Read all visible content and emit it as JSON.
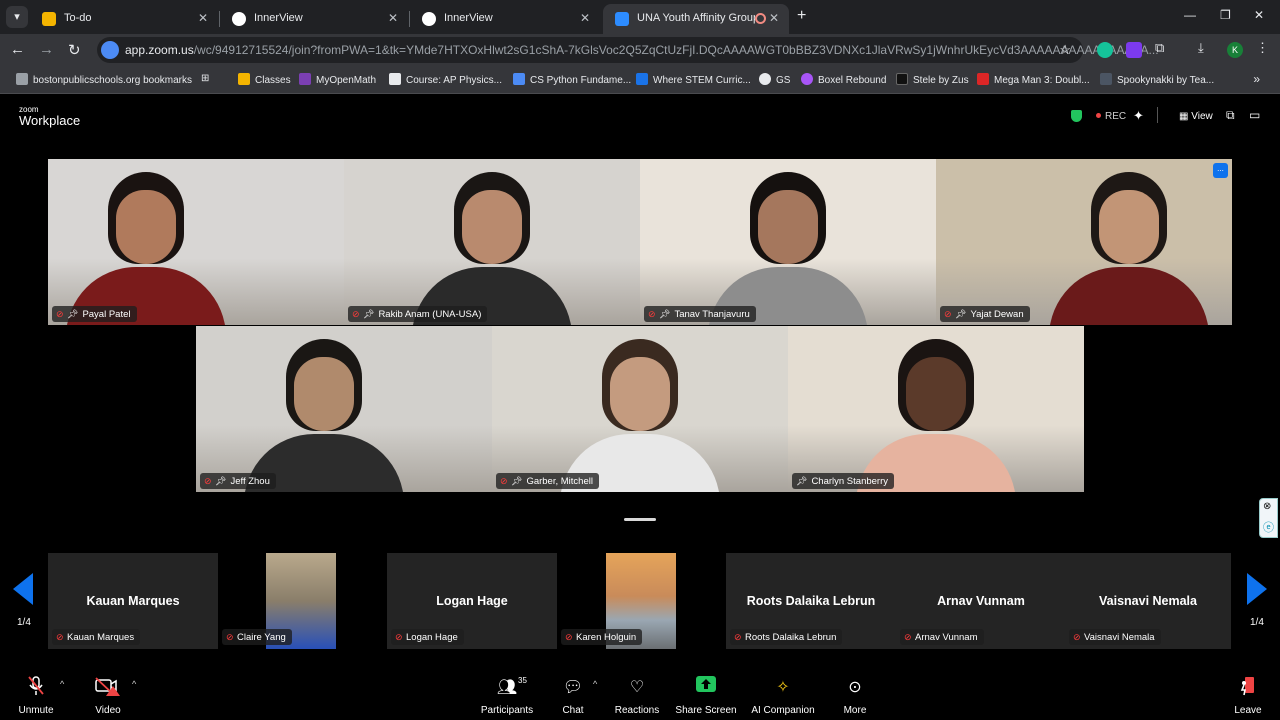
{
  "browser": {
    "tabs": [
      {
        "title": "To-do",
        "favicon_color": "#f4b400"
      },
      {
        "title": "InnerView",
        "favicon_color": "#ffffff"
      },
      {
        "title": "InnerView",
        "favicon_color": "#ffffff"
      },
      {
        "title": "UNA Youth Affinity Group /",
        "favicon_color": "#2d8cff"
      }
    ],
    "url_host": "app.zoom.us",
    "url_path": "/wc/94912715524/join?fromPWA=1&tk=YMde7HTXOxHlwt2sG1cShA-7kGlsVoc2Q5ZqCtUzFjI.DQcAAAAWGT0bBBZ3VDNXc1JlaVRwSy1jWnhrUkEycVd3AAAAAAAAAAAAAAAA...",
    "avatar_letter": "K",
    "bookmarks": [
      {
        "label": "bostonpublicschools.org bookmarks",
        "color": "#9aa0a6"
      },
      {
        "label": "Classes",
        "color": "#f4b400"
      },
      {
        "label": "MyOpenMath",
        "color": "#7b3fb3"
      },
      {
        "label": "Course: AP Physics...",
        "color": "#e8eaed"
      },
      {
        "label": "CS Python Fundame...",
        "color": "#4c8bf5"
      },
      {
        "label": "Where STEM Curric...",
        "color": "#1a73e8"
      },
      {
        "label": "GS",
        "color": "#e8eaed"
      },
      {
        "label": "Boxel Rebound",
        "color": "#a855f7"
      },
      {
        "label": "Stele by Zus",
        "color": "#111111"
      },
      {
        "label": "Mega Man 3: Doubl...",
        "color": "#dc2626"
      },
      {
        "label": "Spookynakki by Tea...",
        "color": "#4b5563"
      }
    ]
  },
  "zoom": {
    "logo_small": "zoom",
    "logo_big": "Workplace",
    "rec_label": "REC",
    "view_label": "View",
    "more_label": "...",
    "participants_top": [
      {
        "name": "Payal Patel",
        "bg": "#d8d6d4",
        "skin": "#b07a5c",
        "hair": "#1a1311",
        "shirt": "#7a1b1b"
      },
      {
        "name": "Rakib Anam (UNA-USA)",
        "bg": "#d6d3cf",
        "skin": "#b98a6e",
        "hair": "#1a1614",
        "shirt": "#2a2a2a"
      },
      {
        "name": "Tanav Thanjavuru",
        "bg": "#e9e3da",
        "skin": "#a5775d",
        "hair": "#15110f",
        "shirt": "#8d8d8d"
      },
      {
        "name": "Yajat Dewan",
        "bg": "#cbbfa9",
        "skin": "#c29576",
        "hair": "#1e1815",
        "shirt": "#6a1a1a"
      }
    ],
    "participants_mid": [
      {
        "name": "Jeff Zhou",
        "bg": "#d2d0cc",
        "skin": "#b08a6c",
        "hair": "#1a1714",
        "shirt": "#2c2c2c"
      },
      {
        "name": "Garber, Mitchell",
        "bg": "#d9d6cf",
        "skin": "#c49b7f",
        "hair": "#3a2a20",
        "shirt": "#e8e8e8"
      },
      {
        "name": "Charlyn Stanberry",
        "bg": "#e4ddd2",
        "skin": "#5b3a2a",
        "hair": "#1a1412",
        "shirt": "#e6b39f"
      }
    ],
    "thumbnails": [
      {
        "name": "Kauan Marques",
        "big_name": "Kauan Marques",
        "video": false
      },
      {
        "name": "Claire Yang",
        "big_name": "",
        "video": true
      },
      {
        "name": "Logan Hage",
        "big_name": "Logan Hage",
        "video": false
      },
      {
        "name": "Karen Holguin",
        "big_name": "",
        "video": true
      },
      {
        "name": "Roots Dalaika Lebrun",
        "big_name": "Roots Dalaika Lebrun",
        "video": false
      },
      {
        "name": "Arnav Vunnam",
        "big_name": "Arnav Vunnam",
        "video": false
      },
      {
        "name": "Vaisnavi Nemala",
        "big_name": "Vaisnavi Nemala",
        "video": false
      }
    ],
    "page_left": "1/4",
    "page_right": "1/4",
    "toolbar": {
      "unmute": "Unmute",
      "video": "Video",
      "participants": "Participants",
      "participant_count": "35",
      "chat": "Chat",
      "reactions": "Reactions",
      "share": "Share Screen",
      "ai": "AI Companion",
      "more": "More",
      "leave": "Leave"
    }
  }
}
